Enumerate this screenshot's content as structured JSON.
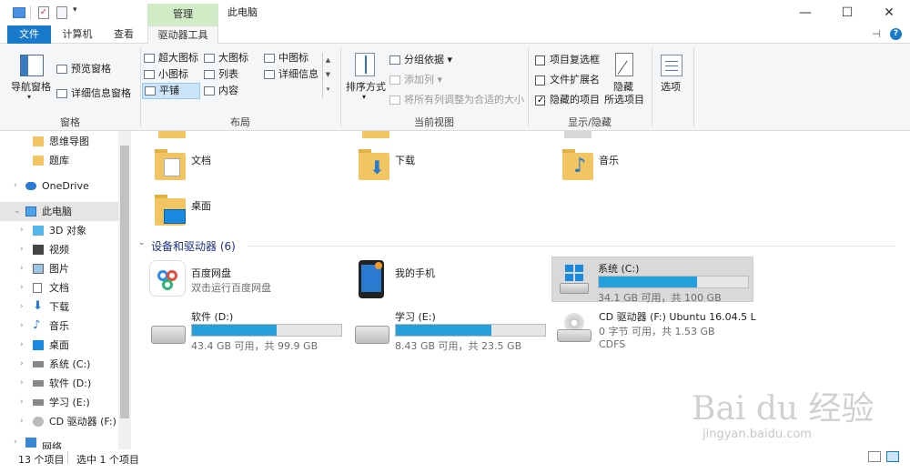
{
  "titlebar": {
    "context_tab": "管理",
    "window_title": "此电脑",
    "minimize": "—",
    "maximize": "☐",
    "close": "✕"
  },
  "tabs": {
    "file": "文件",
    "computer": "计算机",
    "view": "查看",
    "drive_tools": "驱动器工具"
  },
  "ribbon": {
    "panes": {
      "nav_pane": "导航窗格",
      "preview_pane": "预览窗格",
      "details_pane": "详细信息窗格",
      "label": "窗格"
    },
    "layout": {
      "items": [
        "超大图标",
        "大图标",
        "中图标",
        "小图标",
        "列表",
        "详细信息",
        "平铺",
        "内容"
      ],
      "label": "布局"
    },
    "current_view": {
      "sort_by": "排序方式",
      "group_by": "分组依据",
      "add_columns": "添加列",
      "fit_columns": "将所有列调整为合适的大小",
      "label": "当前视图"
    },
    "show_hide": {
      "item_checkboxes": "项目复选框",
      "file_extensions": "文件扩展名",
      "hidden_items": "隐藏的项目",
      "hide_selected_line1": "隐藏",
      "hide_selected_line2": "所选项目",
      "label": "显示/隐藏"
    },
    "options": "选项"
  },
  "sidebar": {
    "items": [
      "思维导图",
      "题库",
      "OneDrive",
      "此电脑",
      "3D 对象",
      "视频",
      "图片",
      "文档",
      "下载",
      "音乐",
      "桌面",
      "系统 (C:)",
      "软件 (D:)",
      "学习 (E:)",
      "CD 驱动器 (F:) U",
      "网络"
    ]
  },
  "content": {
    "folders": [
      "文档",
      "下载",
      "音乐",
      "桌面"
    ],
    "section_title": "设备和驱动器 (6)",
    "devices": {
      "baidu": {
        "name": "百度网盘",
        "sub": "双击运行百度网盘"
      },
      "phone": {
        "name": "我的手机"
      },
      "c": {
        "name": "系统 (C:)",
        "sub": "34.1 GB 可用，共 100 GB",
        "used_fraction": 0.66
      },
      "d": {
        "name": "软件 (D:)",
        "sub": "43.4 GB 可用，共 99.9 GB",
        "used_fraction": 0.57
      },
      "e": {
        "name": "学习 (E:)",
        "sub": "8.43 GB 可用，共 23.5 GB",
        "used_fraction": 0.64
      },
      "f": {
        "name": "CD 驱动器 (F:) Ubuntu 16.04.5 L",
        "sub": "0 字节 可用，共 1.53 GB",
        "sub2": "CDFS"
      }
    }
  },
  "statusbar": {
    "item_count": "13 个项目",
    "selected": "选中 1 个项目"
  },
  "watermark": {
    "brand": "Bai du 经验",
    "url": "jingyan.baidu.com"
  },
  "colors": {
    "accent": "#1979ca",
    "bar": "#26a0da",
    "context_tab": "#d1ebc7"
  }
}
